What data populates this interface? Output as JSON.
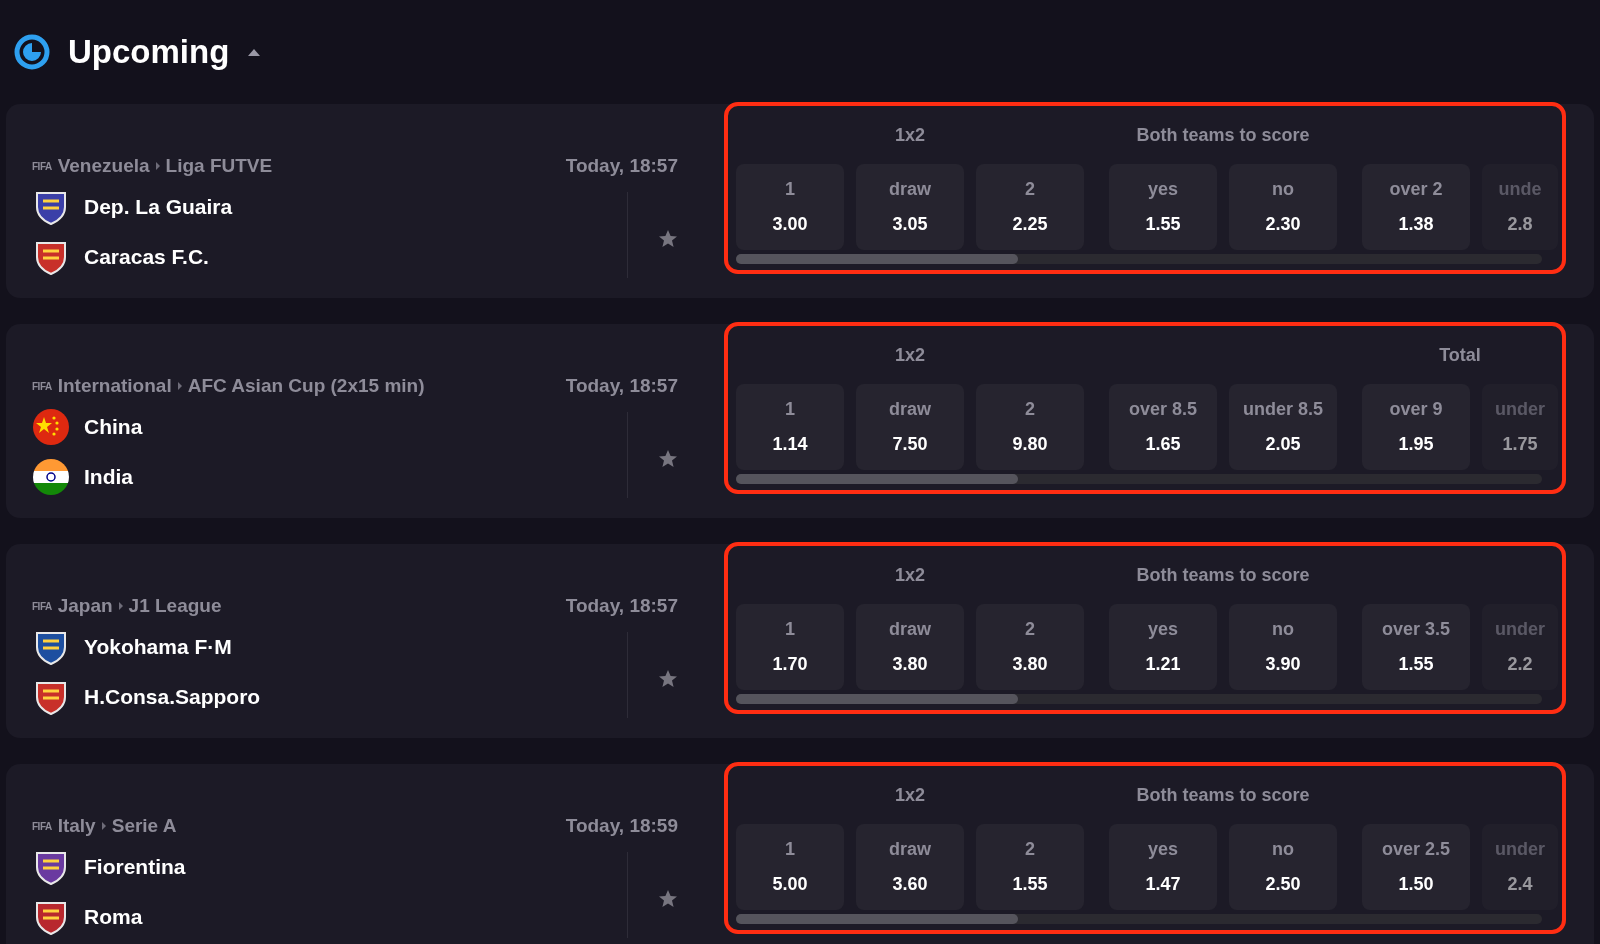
{
  "section": {
    "title": "Upcoming",
    "expanded": true
  },
  "matches": [
    {
      "game": "FIFA",
      "country": "Venezuela",
      "league": "Liga FUTVE",
      "time": "Today, 18:57",
      "favorite": false,
      "highlighted": true,
      "teams": [
        {
          "name": "Dep. La Guaira",
          "kind": "crest",
          "color": "#3b3fa8"
        },
        {
          "name": "Caracas F.C.",
          "kind": "crest",
          "color": "#c8302a"
        }
      ],
      "markets": [
        {
          "title": "1x2",
          "odds": [
            {
              "label": "1",
              "value": "3.00"
            },
            {
              "label": "draw",
              "value": "3.05"
            },
            {
              "label": "2",
              "value": "2.25"
            }
          ]
        },
        {
          "title": "Both teams to score",
          "odds": [
            {
              "label": "yes",
              "value": "1.55"
            },
            {
              "label": "no",
              "value": "2.30"
            }
          ]
        },
        {
          "odds": [
            {
              "label": "over 2",
              "value": "1.38"
            },
            {
              "label": "unde",
              "value": "2.8"
            }
          ]
        }
      ]
    },
    {
      "game": "FIFA",
      "country": "International",
      "league": "AFC Asian Cup (2x15 min)",
      "time": "Today, 18:57",
      "favorite": false,
      "highlighted": true,
      "teams": [
        {
          "name": "China",
          "kind": "flag-china",
          "color": "#de2910"
        },
        {
          "name": "India",
          "kind": "flag-india",
          "color": "#ff9933"
        }
      ],
      "markets": [
        {
          "title": "1x2",
          "odds": [
            {
              "label": "1",
              "value": "1.14"
            },
            {
              "label": "draw",
              "value": "7.50"
            },
            {
              "label": "2",
              "value": "9.80"
            }
          ]
        },
        {
          "odds": [
            {
              "label": "over 8.5",
              "value": "1.65"
            },
            {
              "label": "under 8.5",
              "value": "2.05"
            }
          ]
        },
        {
          "title": "Total",
          "odds": [
            {
              "label": "over 9",
              "value": "1.95"
            },
            {
              "label": "under",
              "value": "1.75"
            }
          ]
        }
      ]
    },
    {
      "game": "FIFA",
      "country": "Japan",
      "league": "J1 League",
      "time": "Today, 18:57",
      "favorite": false,
      "highlighted": true,
      "teams": [
        {
          "name": "Yokohama F·M",
          "kind": "crest",
          "color": "#1d4fa0"
        },
        {
          "name": "H.Consa.Sapporo",
          "kind": "crest",
          "color": "#c8302a"
        }
      ],
      "markets": [
        {
          "title": "1x2",
          "odds": [
            {
              "label": "1",
              "value": "1.70"
            },
            {
              "label": "draw",
              "value": "3.80"
            },
            {
              "label": "2",
              "value": "3.80"
            }
          ]
        },
        {
          "title": "Both teams to score",
          "odds": [
            {
              "label": "yes",
              "value": "1.21"
            },
            {
              "label": "no",
              "value": "3.90"
            }
          ]
        },
        {
          "odds": [
            {
              "label": "over 3.5",
              "value": "1.55"
            },
            {
              "label": "under",
              "value": "2.2"
            }
          ]
        }
      ]
    },
    {
      "game": "FIFA",
      "country": "Italy",
      "league": "Serie A",
      "time": "Today, 18:59",
      "favorite": false,
      "highlighted": true,
      "teams": [
        {
          "name": "Fiorentina",
          "kind": "crest",
          "color": "#6a3aa0"
        },
        {
          "name": "Roma",
          "kind": "crest",
          "color": "#b8282e"
        }
      ],
      "markets": [
        {
          "title": "1x2",
          "odds": [
            {
              "label": "1",
              "value": "5.00"
            },
            {
              "label": "draw",
              "value": "3.60"
            },
            {
              "label": "2",
              "value": "1.55"
            }
          ]
        },
        {
          "title": "Both teams to score",
          "odds": [
            {
              "label": "yes",
              "value": "1.47"
            },
            {
              "label": "no",
              "value": "2.50"
            }
          ]
        },
        {
          "odds": [
            {
              "label": "over 2.5",
              "value": "1.50"
            },
            {
              "label": "under",
              "value": "2.4"
            }
          ]
        }
      ]
    }
  ]
}
